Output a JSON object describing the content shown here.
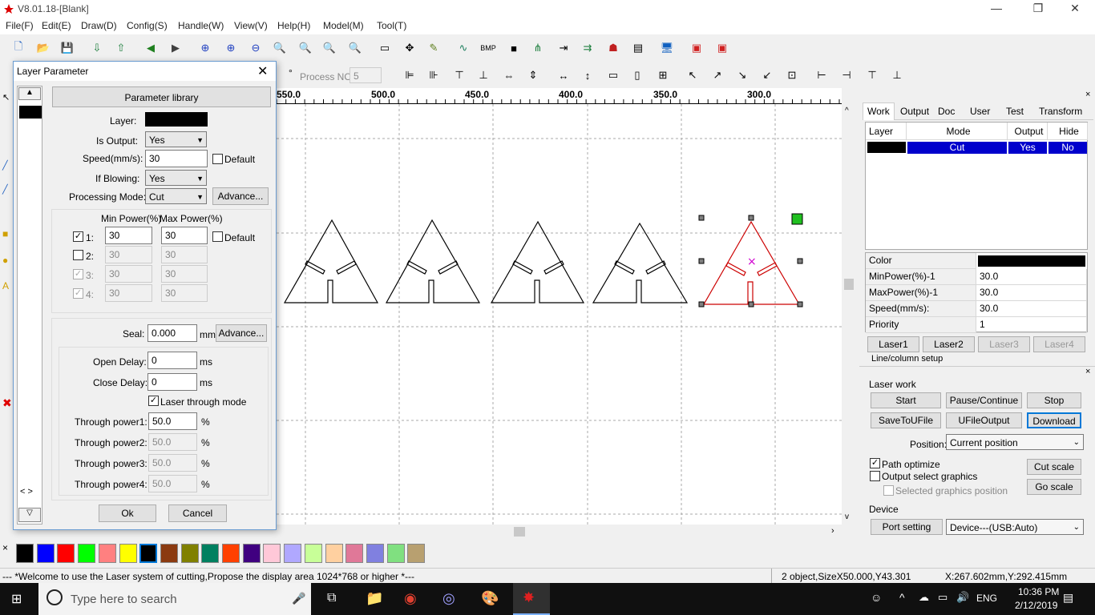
{
  "app": {
    "title": "V8.01.18-[Blank]"
  },
  "menu": [
    "File(F)",
    "Edit(E)",
    "Draw(D)",
    "Config(S)",
    "Handle(W)",
    "View(V)",
    "Help(H)",
    "Model(M)",
    "Tool(T)"
  ],
  "toolbar2": {
    "process_no_label": "Process NO:",
    "process_no_value": "5",
    "degree": "°"
  },
  "ruler": [
    "550.0",
    "500.0",
    "450.0",
    "400.0",
    "350.0",
    "300.0"
  ],
  "dialog": {
    "title": "Layer Parameter",
    "param_library": "Parameter library",
    "layer_label": "Layer:",
    "is_output_label": "Is Output:",
    "is_output": "Yes",
    "speed_label": "Speed(mm/s):",
    "speed": "30",
    "default_label": "Default",
    "blowing_label": "If Blowing:",
    "blowing": "Yes",
    "mode_label": "Processing Mode:",
    "mode": "Cut",
    "advance": "Advance...",
    "min_power_header": "Min Power(%)",
    "max_power_header": "Max Power(%)",
    "powers": [
      {
        "label": "1:",
        "min": "30",
        "max": "30",
        "checked": "✓"
      },
      {
        "label": "2:",
        "min": "30",
        "max": "30",
        "checked": ""
      },
      {
        "label": "3:",
        "min": "30",
        "max": "30",
        "checked": "✓"
      },
      {
        "label": "4:",
        "min": "30",
        "max": "30",
        "checked": "✓"
      }
    ],
    "power_default": "Default",
    "seal_label": "Seal:",
    "seal": "0.000",
    "seal_unit": "mm",
    "seal_advance": "Advance...",
    "open_delay_label": "Open Delay:",
    "open_delay": "0",
    "close_delay_label": "Close Delay:",
    "close_delay": "0",
    "ms": "ms",
    "through_mode": "Laser through mode",
    "through": [
      {
        "label": "Through power1:",
        "value": "50.0"
      },
      {
        "label": "Through power2:",
        "value": "50.0"
      },
      {
        "label": "Through power3:",
        "value": "50.0"
      },
      {
        "label": "Through power4:",
        "value": "50.0"
      }
    ],
    "pct": "%",
    "ok": "Ok",
    "cancel": "Cancel"
  },
  "right_tabs": [
    "Work",
    "Output",
    "Doc",
    "User",
    "Test",
    "Transform"
  ],
  "layer_table": {
    "headers": [
      "Layer",
      "Mode",
      "Output",
      "Hide"
    ],
    "row": {
      "mode": "Cut",
      "output": "Yes",
      "hide": "No"
    }
  },
  "props": [
    {
      "label": "Color",
      "value": ""
    },
    {
      "label": "MinPower(%)-1",
      "value": "30.0"
    },
    {
      "label": "MaxPower(%)-1",
      "value": "30.0"
    },
    {
      "label": "Speed(mm/s):",
      "value": "30.0"
    },
    {
      "label": "Priority",
      "value": "1"
    }
  ],
  "laser_tabs": [
    "Laser1",
    "Laser2",
    "Laser3",
    "Laser4"
  ],
  "line_setup": "Line/column setup",
  "laser_work": {
    "title": "Laser work",
    "start": "Start",
    "pause": "Pause/Continue",
    "stop": "Stop",
    "save": "SaveToUFile",
    "ufile": "UFileOutput",
    "download": "Download",
    "position_label": "Position:",
    "position": "Current position",
    "path_optimize": "Path optimize",
    "output_select": "Output select graphics",
    "selected_pos": "Selected graphics position",
    "cut_scale": "Cut scale",
    "go_scale": "Go scale"
  },
  "device": {
    "title": "Device",
    "port": "Port setting",
    "device": "Device---(USB:Auto)"
  },
  "status": {
    "message": "--- *Welcome to use the Laser system of cutting,Propose the display area 1024*768 or higher *---",
    "objects": "2 object,SizeX50.000,Y43.301",
    "coords": "X:267.602mm,Y:292.415mm"
  },
  "taskbar": {
    "search": "Type here to search",
    "lang": "ENG",
    "time": "10:36 PM",
    "date": "2/12/2019"
  },
  "palette": [
    "#000000",
    "#0000ff",
    "#ff0000",
    "#00ff00",
    "#ff8080",
    "#ffff00",
    "#000000",
    "#8b3a10",
    "#808000",
    "#008060",
    "#ff4000",
    "#400080",
    "#ffc8d8",
    "#b0a8ff",
    "#c8ff98",
    "#ffd0a0",
    "#e07898",
    "#8080e0",
    "#80e080",
    "#b8a070"
  ],
  "colors": {
    "accent": "#0000cc",
    "selected_shape": "#cc0000"
  }
}
